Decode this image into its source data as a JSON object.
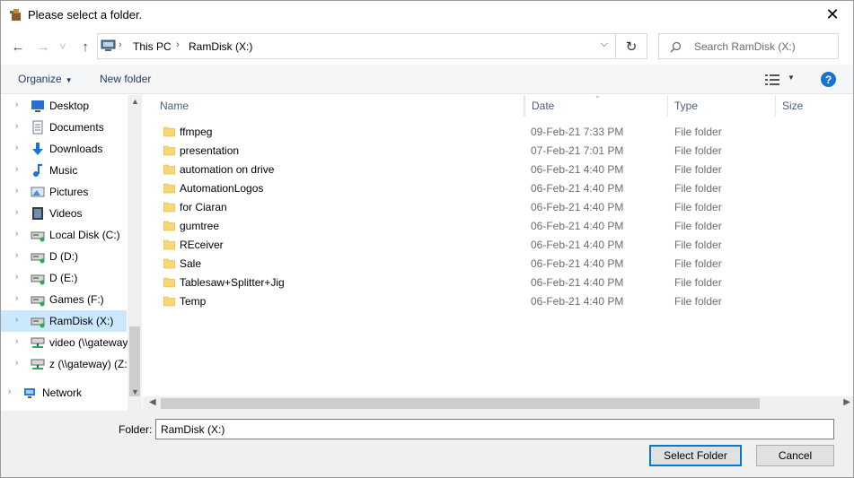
{
  "window": {
    "title": "Please select a folder.",
    "close_glyph": "✕"
  },
  "nav": {
    "back_glyph": "←",
    "forward_glyph": "→",
    "recent_glyph": "˅",
    "up_glyph": "↑",
    "breadcrumb": [
      "This PC",
      "RamDisk (X:)"
    ],
    "refresh_glyph": "↻",
    "search_placeholder": "Search RamDisk (X:)"
  },
  "toolbar": {
    "organize_label": "Organize",
    "new_folder_label": "New folder",
    "help_label": "?"
  },
  "sidebar": {
    "items": [
      {
        "label": "Desktop",
        "icon": "desktop-icon"
      },
      {
        "label": "Documents",
        "icon": "documents-icon"
      },
      {
        "label": "Downloads",
        "icon": "downloads-icon"
      },
      {
        "label": "Music",
        "icon": "music-icon"
      },
      {
        "label": "Pictures",
        "icon": "pictures-icon"
      },
      {
        "label": "Videos",
        "icon": "videos-icon"
      },
      {
        "label": "Local Disk (C:)",
        "icon": "drive-icon"
      },
      {
        "label": "D (D:)",
        "icon": "drive-icon"
      },
      {
        "label": "D (E:)",
        "icon": "drive-icon"
      },
      {
        "label": "Games (F:)",
        "icon": "drive-icon"
      },
      {
        "label": "RamDisk (X:)",
        "icon": "drive-icon",
        "selected": true
      },
      {
        "label": "video (\\\\gateway",
        "icon": "network-drive-icon"
      },
      {
        "label": "z (\\\\gateway) (Z:",
        "icon": "network-drive-icon"
      }
    ],
    "network_label": "Network"
  },
  "columns": {
    "name": "Name",
    "date": "Date",
    "type": "Type",
    "size": "Size"
  },
  "files": [
    {
      "name": "ffmpeg",
      "date": "09-Feb-21 7:33 PM",
      "type": "File folder"
    },
    {
      "name": "presentation",
      "date": "07-Feb-21 7:01 PM",
      "type": "File folder"
    },
    {
      "name": "automation on drive",
      "date": "06-Feb-21 4:40 PM",
      "type": "File folder"
    },
    {
      "name": "AutomationLogos",
      "date": "06-Feb-21 4:40 PM",
      "type": "File folder"
    },
    {
      "name": "for Ciaran",
      "date": "06-Feb-21 4:40 PM",
      "type": "File folder"
    },
    {
      "name": "gumtree",
      "date": "06-Feb-21 4:40 PM",
      "type": "File folder"
    },
    {
      "name": "REceiver",
      "date": "06-Feb-21 4:40 PM",
      "type": "File folder"
    },
    {
      "name": "Sale",
      "date": "06-Feb-21 4:40 PM",
      "type": "File folder"
    },
    {
      "name": "Tablesaw+Splitter+Jig",
      "date": "06-Feb-21 4:40 PM",
      "type": "File folder"
    },
    {
      "name": "Temp",
      "date": "06-Feb-21 4:40 PM",
      "type": "File folder"
    }
  ],
  "footer": {
    "folder_label": "Folder:",
    "folder_value": "RamDisk (X:)",
    "select_label": "Select Folder",
    "cancel_label": "Cancel"
  },
  "colors": {
    "accent": "#0078d7",
    "selection": "#cce8ff",
    "folder": "#f8d775"
  }
}
